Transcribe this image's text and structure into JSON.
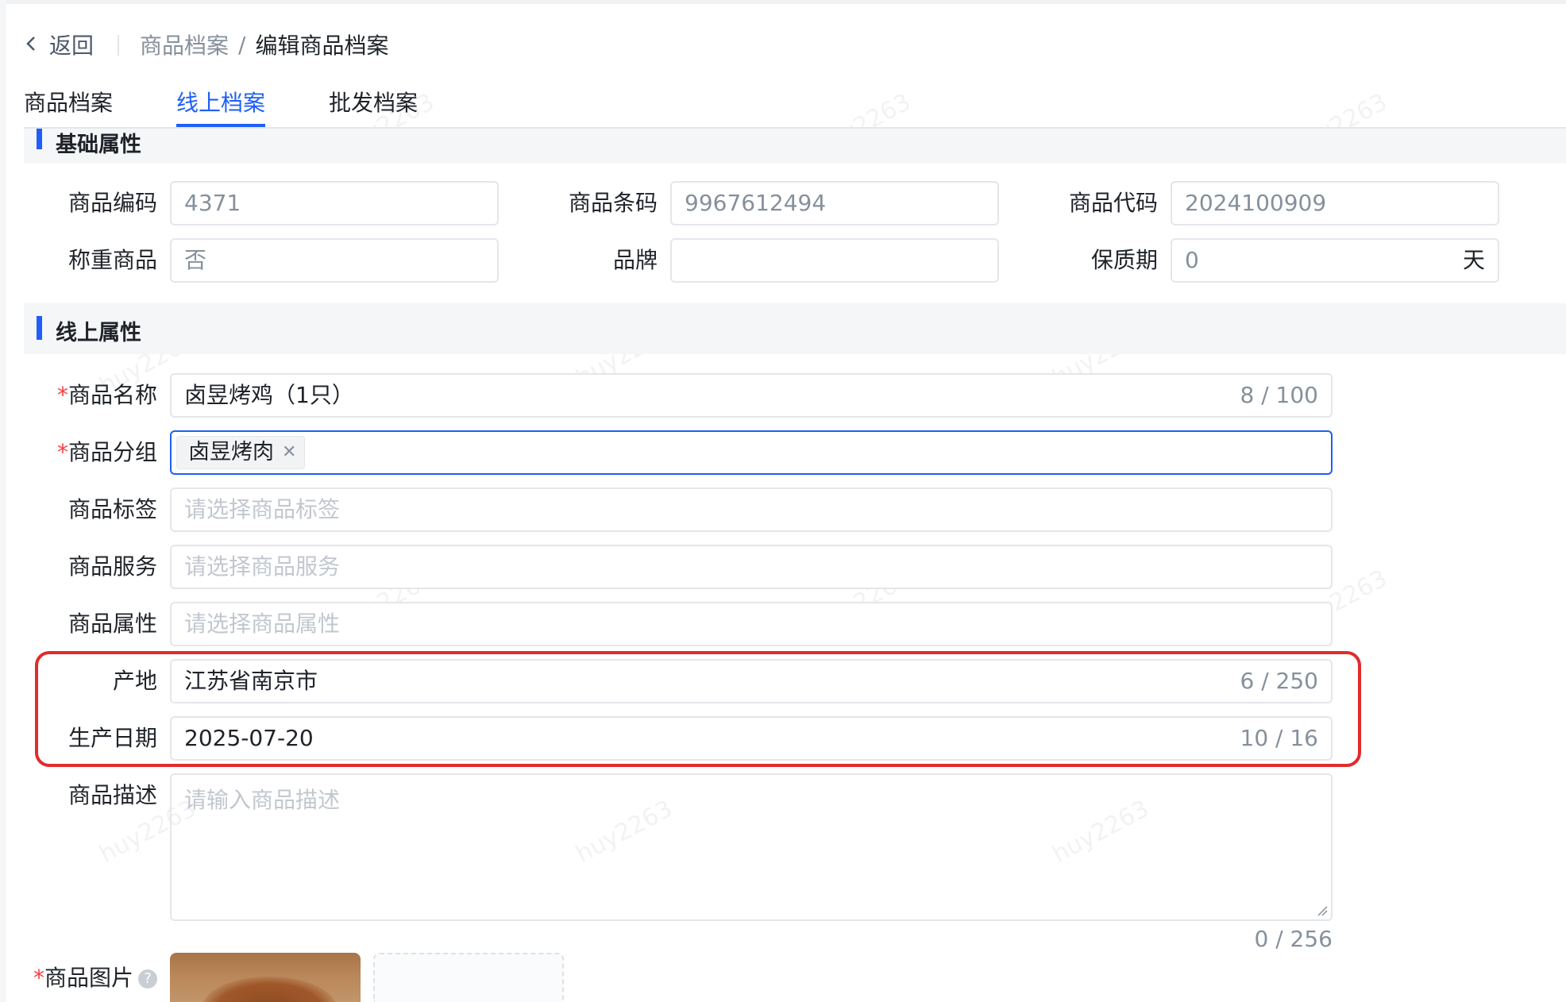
{
  "header": {
    "back_label": "返回",
    "breadcrumb_parent": "商品档案",
    "breadcrumb_sep": "/",
    "breadcrumb_current": "编辑商品档案"
  },
  "tabs": [
    {
      "label": "商品档案",
      "active": false
    },
    {
      "label": "线上档案",
      "active": true
    },
    {
      "label": "批发档案",
      "active": false
    }
  ],
  "sections": {
    "basic": "基础属性",
    "online": "线上属性"
  },
  "basic_fields": {
    "code_label": "商品编码",
    "code_value": "4371",
    "barcode_label": "商品条码",
    "barcode_value": "9967612494",
    "sku_label": "商品代码",
    "sku_value": "2024100909",
    "weighing_label": "称重商品",
    "weighing_value": "否",
    "brand_label": "品牌",
    "brand_value": "",
    "shelf_label": "保质期",
    "shelf_value": "0",
    "shelf_unit": "天"
  },
  "online_fields": {
    "name_label": "商品名称",
    "name_value": "卤昱烤鸡（1只）",
    "name_count": "8 / 100",
    "group_label": "商品分组",
    "group_tag": "卤昱烤肉",
    "tag_label": "商品标签",
    "tag_placeholder": "请选择商品标签",
    "service_label": "商品服务",
    "service_placeholder": "请选择商品服务",
    "attr_label": "商品属性",
    "attr_placeholder": "请选择商品属性",
    "origin_label": "产地",
    "origin_value": "江苏省南京市",
    "origin_count": "6 / 250",
    "date_label": "生产日期",
    "date_value": "2025-07-20",
    "date_count": "10 / 16",
    "desc_label": "商品描述",
    "desc_placeholder": "请输入商品描述",
    "desc_count": "0 / 256",
    "image_label": "商品图片"
  },
  "required_mark": "*",
  "watermark": "huy2263",
  "icons": {
    "back": "chevron-left-icon",
    "remove_tag": "close-icon",
    "help": "question-circle-icon"
  },
  "colors": {
    "primary": "#1f5ef7",
    "required": "#f53f3f",
    "highlight": "#e02c2c"
  }
}
